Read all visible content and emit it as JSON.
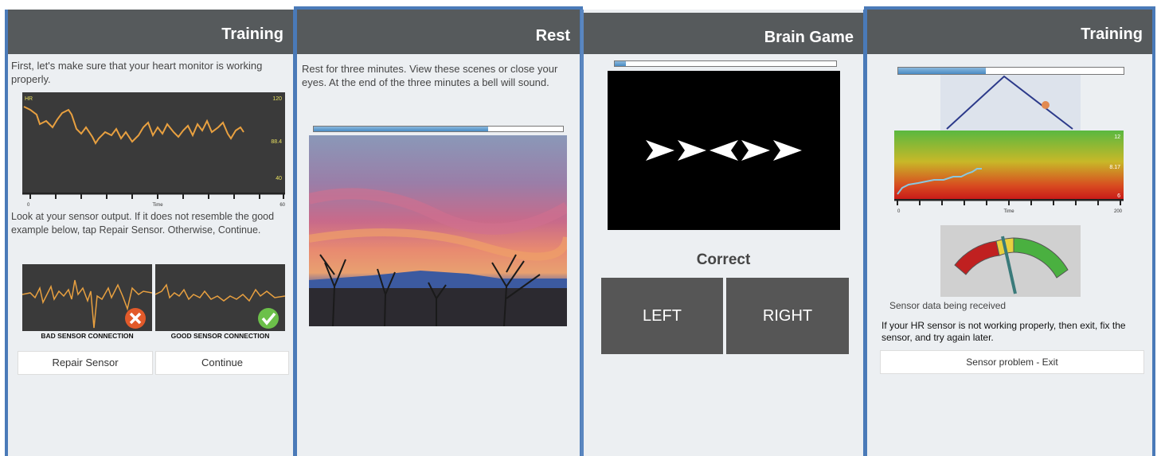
{
  "panel1": {
    "title": "Training",
    "intro": "First, let's make sure that your heart monitor is working properly.",
    "chart": {
      "ylabel": "HR",
      "ymax": "120",
      "ymin": "40",
      "current": "88.4",
      "xlabel": "Time",
      "xmin": "0",
      "xmax": "60"
    },
    "instructions": "Look at your sensor output. If it does not resemble the good example below, tap Repair Sensor. Otherwise, Continue.",
    "bad_label": "BAD SENSOR CONNECTION",
    "good_label": "GOOD SENSOR CONNECTION",
    "repair_button": "Repair Sensor",
    "continue_button": "Continue",
    "line_color": "#e8a040"
  },
  "panel2": {
    "title": "Rest",
    "text": "Rest for three minutes. View these scenes or close your eyes. At the end of the three minutes a bell will sound.",
    "progress": 0.7
  },
  "panel3": {
    "title": "Brain Game",
    "progress": 0.05,
    "arrows": [
      "right",
      "right",
      "left",
      "right",
      "right"
    ],
    "feedback": "Correct",
    "left_button": "LEFT",
    "right_button": "RIGHT"
  },
  "panel4": {
    "title": "Training",
    "progress": 0.39,
    "chart": {
      "ymax": "12",
      "current": "8.17",
      "ymin": "6",
      "xlabel": "Time",
      "xmin": "0",
      "xmax": "200"
    },
    "status": "Sensor data being received",
    "instructions": "If your HR sensor is not working properly, then exit, fix the sensor, and try again later.",
    "exit_button": "Sensor problem - Exit"
  }
}
